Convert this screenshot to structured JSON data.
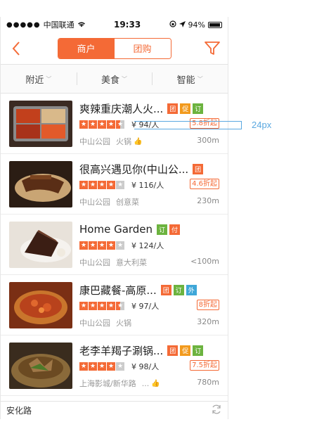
{
  "status_bar": {
    "carrier": "中国联通",
    "time": "19:33",
    "battery": "94%"
  },
  "nav": {
    "segments": [
      "商户",
      "团购"
    ],
    "active_segment": 0
  },
  "tabs": [
    "附近",
    "美食",
    "智能"
  ],
  "items": [
    {
      "name": "爽辣重庆潮人火...",
      "badges": [
        "团",
        "促",
        "订"
      ],
      "rating": 4.5,
      "price": "¥ 94/人",
      "discount": "5.8折起",
      "area": "中山公园",
      "category": "火锅",
      "thumbs": true,
      "distance": "300m"
    },
    {
      "name": "很高兴遇见你(中山公...",
      "badges": [
        "团"
      ],
      "rating": 4,
      "price": "¥ 116/人",
      "discount": "4.6折起",
      "area": "中山公园",
      "category": "创意菜",
      "thumbs": false,
      "distance": "230m"
    },
    {
      "name": "Home Garden",
      "badges": [
        "订",
        "付"
      ],
      "rating": 4,
      "price": "¥ 124/人",
      "discount": "",
      "area": "中山公园",
      "category": "意大利菜",
      "thumbs": false,
      "distance": "<100m"
    },
    {
      "name": "康巴藏餐-高原...",
      "badges": [
        "团",
        "订",
        "外"
      ],
      "rating": 4.5,
      "price": "¥ 97/人",
      "discount": "8折起",
      "area": "中山公园",
      "category": "火锅",
      "thumbs": false,
      "distance": "320m"
    },
    {
      "name": "老李羊羯子涮锅...",
      "badges": [
        "团",
        "促",
        "订"
      ],
      "rating": 4,
      "price": "¥ 98/人",
      "discount": "7.5折起",
      "area": "上海影城/新华路",
      "category": "...",
      "thumbs": true,
      "distance": "780m"
    }
  ],
  "bottom": {
    "location": "安化路"
  },
  "annotation": {
    "label": "24px"
  },
  "colors": {
    "accent": "#f46a36",
    "badge_cu": "#f29a1d",
    "badge_ding": "#6cb33f",
    "badge_wai": "#3fa7d8",
    "annotation": "#5aa8e0"
  },
  "icons": [
    "back-chevron-icon",
    "filter-funnel-icon",
    "refresh-icon",
    "wifi-icon",
    "location-arrow-icon",
    "thumbs-up-icon"
  ]
}
